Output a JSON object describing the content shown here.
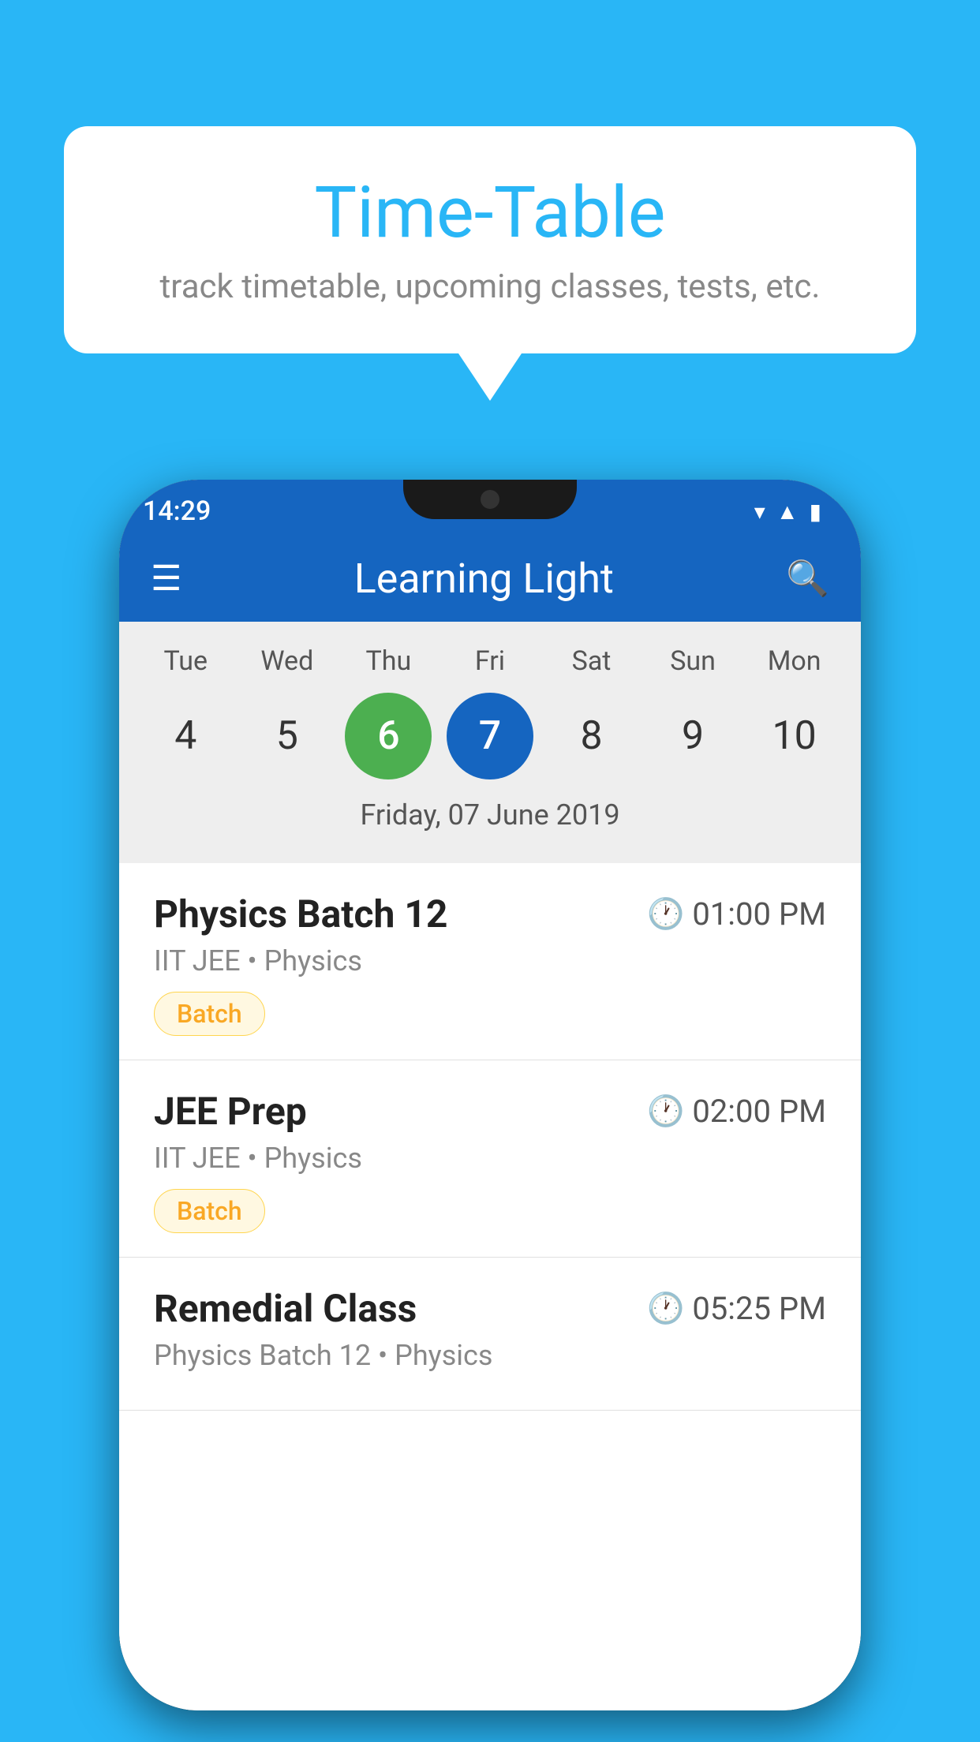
{
  "background_color": "#29B6F6",
  "bubble": {
    "title": "Time-Table",
    "subtitle": "track timetable, upcoming classes, tests, etc."
  },
  "phone": {
    "status": {
      "time": "14:29"
    },
    "app_bar": {
      "title": "Learning Light"
    },
    "calendar": {
      "days": [
        {
          "label": "Tue",
          "num": "4",
          "state": "normal"
        },
        {
          "label": "Wed",
          "num": "5",
          "state": "normal"
        },
        {
          "label": "Thu",
          "num": "6",
          "state": "today"
        },
        {
          "label": "Fri",
          "num": "7",
          "state": "selected"
        },
        {
          "label": "Sat",
          "num": "8",
          "state": "normal"
        },
        {
          "label": "Sun",
          "num": "9",
          "state": "normal"
        },
        {
          "label": "Mon",
          "num": "10",
          "state": "normal"
        }
      ],
      "selected_date_label": "Friday, 07 June 2019"
    },
    "classes": [
      {
        "name": "Physics Batch 12",
        "time": "01:00 PM",
        "meta": "IIT JEE • Physics",
        "badge": "Batch"
      },
      {
        "name": "JEE Prep",
        "time": "02:00 PM",
        "meta": "IIT JEE • Physics",
        "badge": "Batch"
      },
      {
        "name": "Remedial Class",
        "time": "05:25 PM",
        "meta": "Physics Batch 12 • Physics",
        "badge": ""
      }
    ]
  }
}
